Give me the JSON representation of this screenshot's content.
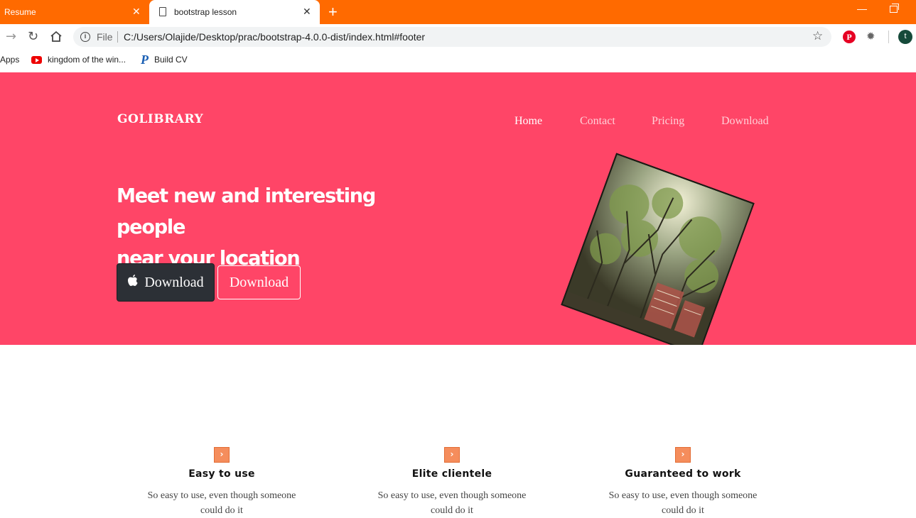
{
  "browser": {
    "tabs": [
      {
        "title": "Resume",
        "active": false
      },
      {
        "title": "bootstrap lesson",
        "active": true
      }
    ],
    "address": {
      "scheme_label": "File",
      "url": "C:/Users/Olajide/Desktop/prac/bootstrap-4.0.0-dist/index.html#footer"
    },
    "profile_initial": "t",
    "bookmarks": [
      {
        "label": "Apps",
        "icon": "apps-icon"
      },
      {
        "label": "kingdom of the win...",
        "icon": "youtube-icon"
      },
      {
        "label": "Build CV",
        "icon": "p-logo-icon"
      }
    ]
  },
  "page": {
    "brand": "GOLIBRARY",
    "nav": [
      "Home",
      "Contact",
      "Pricing",
      "Download"
    ],
    "headline_line1": "Meet new and interesting people",
    "headline_line2": "near your location",
    "buttons": {
      "primary": "Download",
      "secondary": "Download"
    },
    "features": [
      {
        "title": "Easy to use",
        "desc_line1": "So easy to use, even though someone",
        "desc_line2": "could do it"
      },
      {
        "title": "Elite clientele",
        "desc_line1": "So easy to use, even though someone",
        "desc_line2": "could do it"
      },
      {
        "title": "Guaranteed to work",
        "desc_line1": "So easy to use, even though someone",
        "desc_line2": "could do it"
      }
    ]
  },
  "colors": {
    "tabbar": "#ff6a00",
    "hero": "#ff4567",
    "dark_button": "#2c3036",
    "feature_icon": "#f58d5c"
  }
}
